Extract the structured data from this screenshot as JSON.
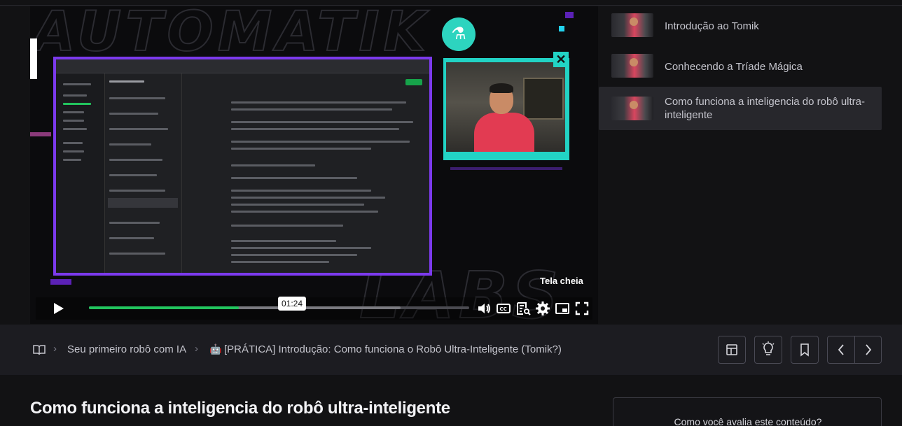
{
  "video": {
    "current_time": "01:24",
    "progress_fraction": 0.395,
    "buffered_fraction": 0.82,
    "fullscreen_tooltip": "Tela cheia"
  },
  "playlist": {
    "items": [
      {
        "title": "Introdução ao Tomik",
        "active": false
      },
      {
        "title": "Conhecendo a Tríade Mágica",
        "active": false
      },
      {
        "title": "Como funciona a inteligencia do robô ultra-inteligente",
        "active": true
      }
    ]
  },
  "breadcrumb": {
    "course": "Seu primeiro robô com IA",
    "lesson": "[PRÁTICA] Introdução: Como funciona o Robô Ultra-Inteligente (Tomik?)"
  },
  "lesson": {
    "title": "Como funciona a inteligencia do robô ultra-inteligente"
  },
  "rating": {
    "question": "Como você avalia este conteúdo?"
  },
  "colors": {
    "accent_progress": "#22c55e",
    "brand_purple": "#7c3aed",
    "brand_teal": "#22d3c5"
  },
  "icons": [
    "book-icon",
    "play-icon",
    "volume-icon",
    "captions-icon",
    "transcript-icon",
    "settings-icon",
    "pip-icon",
    "fullscreen-icon",
    "layout-icon",
    "lightbulb-icon",
    "bookmark-icon",
    "chevron-left-icon",
    "chevron-right-icon",
    "flask-icon",
    "close-icon"
  ]
}
